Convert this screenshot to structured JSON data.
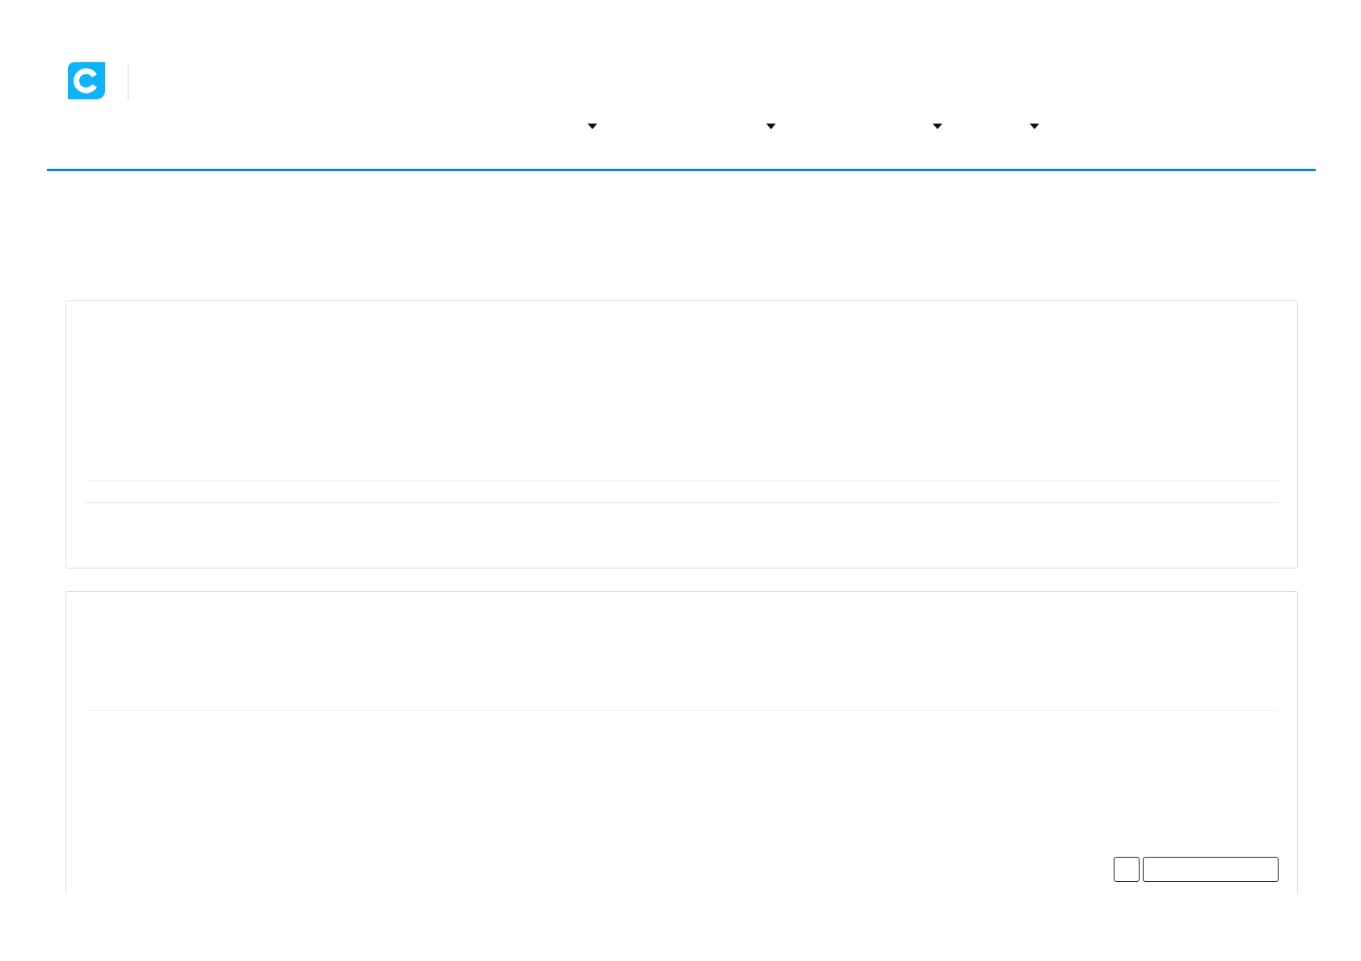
{
  "header": {
    "logo": {
      "kind": "logo"
    }
  },
  "nav": [
    {
      "kind": "dropdown"
    },
    {
      "kind": "dropdown"
    },
    {
      "kind": "dropdown"
    },
    {
      "kind": "dropdown"
    }
  ],
  "cards": [
    {
      "rows": [
        {
          "kind": "blank"
        },
        {
          "kind": "blank"
        },
        {
          "kind": "blank"
        }
      ]
    },
    {
      "rows": [
        {
          "kind": "blank"
        },
        {
          "kind": "footer"
        }
      ],
      "buttons": [
        {
          "kind": "icon"
        },
        {
          "kind": "wide"
        }
      ]
    }
  ]
}
